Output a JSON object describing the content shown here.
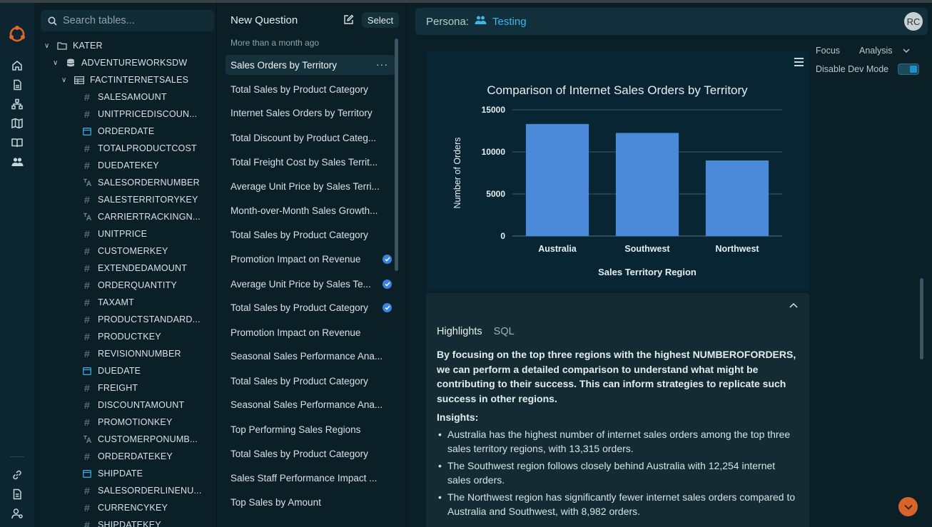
{
  "rail": {
    "top": [
      "logo-icon",
      "home-icon",
      "document-icon",
      "hierarchy-icon",
      "map-icon",
      "book-icon",
      "users-icon"
    ],
    "bottom": [
      "link-icon",
      "file-icon",
      "user-settings-icon"
    ]
  },
  "tree": {
    "search_placeholder": "Search tables...",
    "root": "KATER",
    "database": "ADVENTUREWORKSDW",
    "table": "FACTINTERNETSALES",
    "columns": [
      {
        "name": "SALESAMOUNT",
        "icon": "hash-icon"
      },
      {
        "name": "UNITPRICEDISCOUN...",
        "icon": "hash-icon"
      },
      {
        "name": "ORDERDATE",
        "icon": "calendar-icon"
      },
      {
        "name": "TOTALPRODUCTCOST",
        "icon": "hash-icon"
      },
      {
        "name": "DUEDATEKEY",
        "icon": "hash-icon"
      },
      {
        "name": "SALESORDERNUMBER",
        "icon": "text-icon"
      },
      {
        "name": "SALESTERRITORYKEY",
        "icon": "hash-icon"
      },
      {
        "name": "CARRIERTRACKINGN...",
        "icon": "text-icon"
      },
      {
        "name": "UNITPRICE",
        "icon": "hash-icon"
      },
      {
        "name": "CUSTOMERKEY",
        "icon": "hash-icon"
      },
      {
        "name": "EXTENDEDAMOUNT",
        "icon": "hash-icon"
      },
      {
        "name": "ORDERQUANTITY",
        "icon": "hash-icon"
      },
      {
        "name": "TAXAMT",
        "icon": "hash-icon"
      },
      {
        "name": "PRODUCTSTANDARD...",
        "icon": "hash-icon"
      },
      {
        "name": "PRODUCTKEY",
        "icon": "hash-icon"
      },
      {
        "name": "REVISIONNUMBER",
        "icon": "hash-icon"
      },
      {
        "name": "DUEDATE",
        "icon": "calendar-icon"
      },
      {
        "name": "FREIGHT",
        "icon": "hash-icon"
      },
      {
        "name": "DISCOUNTAMOUNT",
        "icon": "hash-icon"
      },
      {
        "name": "PROMOTIONKEY",
        "icon": "hash-icon"
      },
      {
        "name": "CUSTOMERPONUMB...",
        "icon": "text-icon"
      },
      {
        "name": "ORDERDATEKEY",
        "icon": "hash-icon"
      },
      {
        "name": "SHIPDATE",
        "icon": "calendar-icon"
      },
      {
        "name": "SALESORDERLINENU...",
        "icon": "hash-icon"
      },
      {
        "name": "CURRENCYKEY",
        "icon": "hash-icon"
      },
      {
        "name": "SHIPDATEKEY",
        "icon": "hash-icon"
      }
    ]
  },
  "questions": {
    "title": "New Question",
    "select_label": "Select",
    "group_label": "More than a month ago",
    "items": [
      {
        "label": "Sales Orders by Territory",
        "active": true,
        "verified": false
      },
      {
        "label": "Total Sales by Product Category",
        "active": false,
        "verified": false
      },
      {
        "label": "Internet Sales Orders by Territory",
        "active": false,
        "verified": false
      },
      {
        "label": "Total Discount by Product Categ...",
        "active": false,
        "verified": false
      },
      {
        "label": "Total Freight Cost by Sales Territ...",
        "active": false,
        "verified": false
      },
      {
        "label": "Average Unit Price by Sales Terri...",
        "active": false,
        "verified": false
      },
      {
        "label": "Month-over-Month Sales Growth...",
        "active": false,
        "verified": false
      },
      {
        "label": "Total Sales by Product Category",
        "active": false,
        "verified": false
      },
      {
        "label": "Promotion Impact on Revenue",
        "active": false,
        "verified": true
      },
      {
        "label": "Average Unit Price by Sales Te...",
        "active": false,
        "verified": true
      },
      {
        "label": "Total Sales by Product Category",
        "active": false,
        "verified": true
      },
      {
        "label": "Promotion Impact on Revenue",
        "active": false,
        "verified": false
      },
      {
        "label": "Seasonal Sales Performance Ana...",
        "active": false,
        "verified": false
      },
      {
        "label": "Total Sales by Product Category",
        "active": false,
        "verified": false
      },
      {
        "label": "Seasonal Sales Performance Ana...",
        "active": false,
        "verified": false
      },
      {
        "label": "Top Performing Sales Regions",
        "active": false,
        "verified": false
      },
      {
        "label": "Total Sales by Product Category",
        "active": false,
        "verified": false
      },
      {
        "label": "Sales Staff Performance Impact ...",
        "active": false,
        "verified": false
      },
      {
        "label": "Top Sales by Amount",
        "active": false,
        "verified": false
      }
    ]
  },
  "persona": {
    "label": "Persona:",
    "value": "Testing",
    "avatar": "RC"
  },
  "controls": {
    "focus": "Focus",
    "mode": "Analysis",
    "dev_mode_label": "Disable Dev Mode",
    "dev_mode_on": true
  },
  "chart_data": {
    "type": "bar",
    "title": "Comparison of Internet Sales Orders by Territory",
    "xlabel": "Sales Territory Region",
    "ylabel": "Number of Orders",
    "categories": [
      "Australia",
      "Southwest",
      "Northwest"
    ],
    "values": [
      13315,
      12254,
      8982
    ],
    "ylim": [
      0,
      15000
    ],
    "yticks": [
      0,
      5000,
      10000,
      15000
    ],
    "grid": true,
    "bar_color": "#4a8ad8"
  },
  "highlights": {
    "tabs": [
      "Highlights",
      "SQL"
    ],
    "lead": "By focusing on the top three regions with the highest NUMBEROFORDERS, we can perform a detailed comparison to understand what might be contributing to their success. This can inform strategies to replicate such success in other regions.",
    "insights_label": "Insights:",
    "insights": [
      "Australia has the highest number of internet sales orders among the top three sales territory regions, with 13,315 orders.",
      "The Southwest region follows closely behind Australia with 12,254 internet sales orders.",
      "The Northwest region has significantly fewer internet sales orders compared to Australia and Southwest, with 8,982 orders."
    ]
  }
}
